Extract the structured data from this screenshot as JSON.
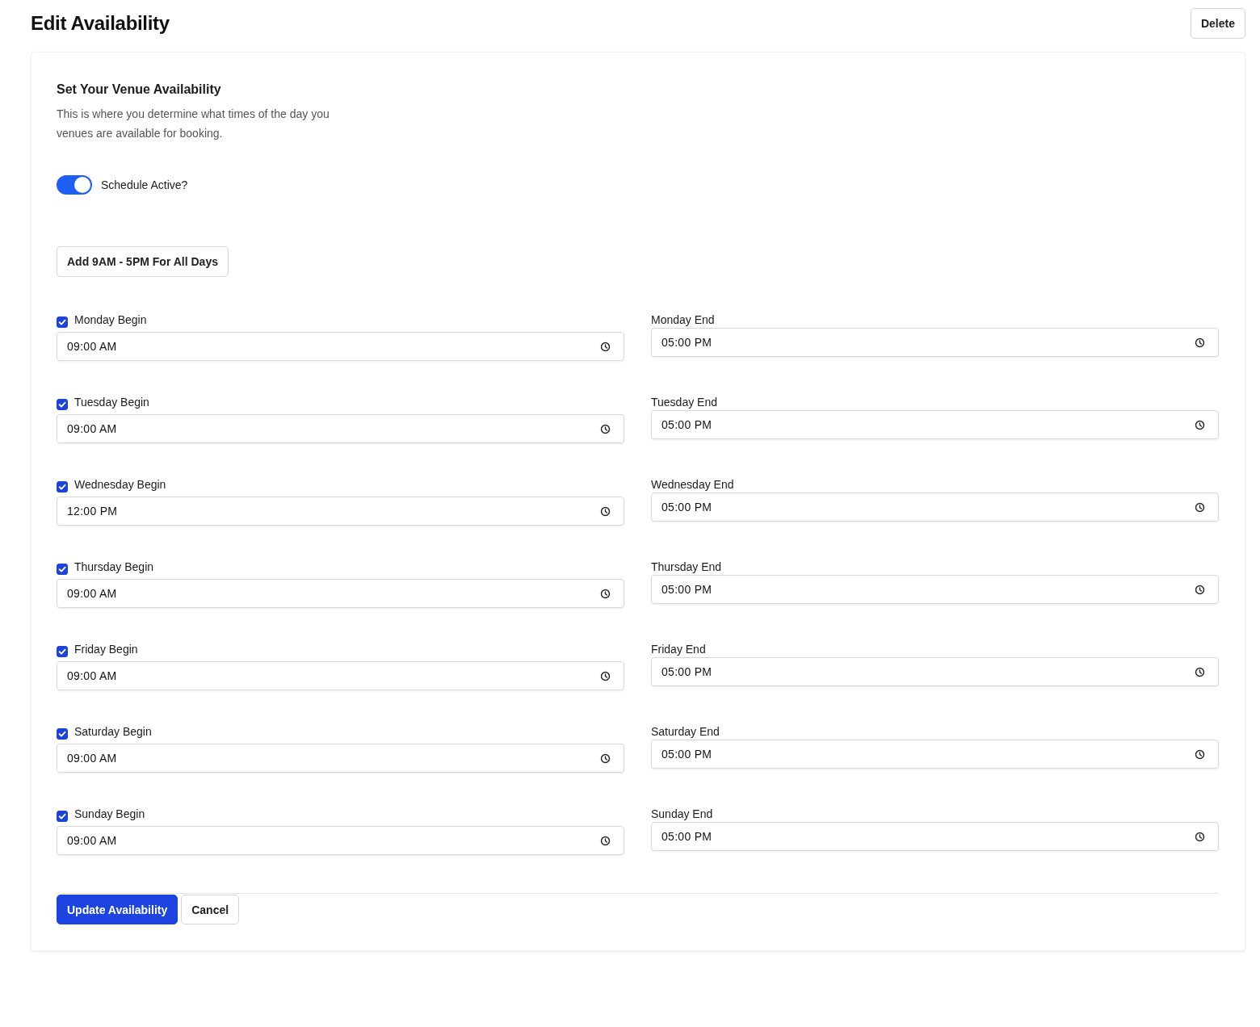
{
  "page": {
    "title": "Edit Availability",
    "delete_button": "Delete"
  },
  "section": {
    "title": "Set Your Venue Availability",
    "description": "This is where you determine what times of the day you venues are available for booking."
  },
  "schedule_toggle": {
    "label": "Schedule Active?",
    "on": true
  },
  "preset_button": "Add 9AM - 5PM For All Days",
  "days": [
    {
      "begin": {
        "label": "Monday Begin",
        "checked": true,
        "value": "09:00 AM"
      },
      "end": {
        "label": "Monday End",
        "value": "05:00 PM"
      }
    },
    {
      "begin": {
        "label": "Tuesday Begin",
        "checked": true,
        "value": "09:00 AM"
      },
      "end": {
        "label": "Tuesday End",
        "value": "05:00 PM"
      }
    },
    {
      "begin": {
        "label": "Wednesday Begin",
        "checked": true,
        "value": "12:00 PM"
      },
      "end": {
        "label": "Wednesday End",
        "value": "05:00 PM"
      }
    },
    {
      "begin": {
        "label": "Thursday Begin",
        "checked": true,
        "value": "09:00 AM"
      },
      "end": {
        "label": "Thursday End",
        "value": "05:00 PM"
      }
    },
    {
      "begin": {
        "label": "Friday Begin",
        "checked": true,
        "value": "09:00 AM"
      },
      "end": {
        "label": "Friday End",
        "value": "05:00 PM"
      }
    },
    {
      "begin": {
        "label": "Saturday Begin",
        "checked": true,
        "value": "09:00 AM"
      },
      "end": {
        "label": "Saturday End",
        "value": "05:00 PM"
      }
    },
    {
      "begin": {
        "label": "Sunday Begin",
        "checked": true,
        "value": "09:00 AM"
      },
      "end": {
        "label": "Sunday End",
        "value": "05:00 PM"
      }
    }
  ],
  "actions": {
    "submit": "Update Availability",
    "cancel": "Cancel"
  }
}
